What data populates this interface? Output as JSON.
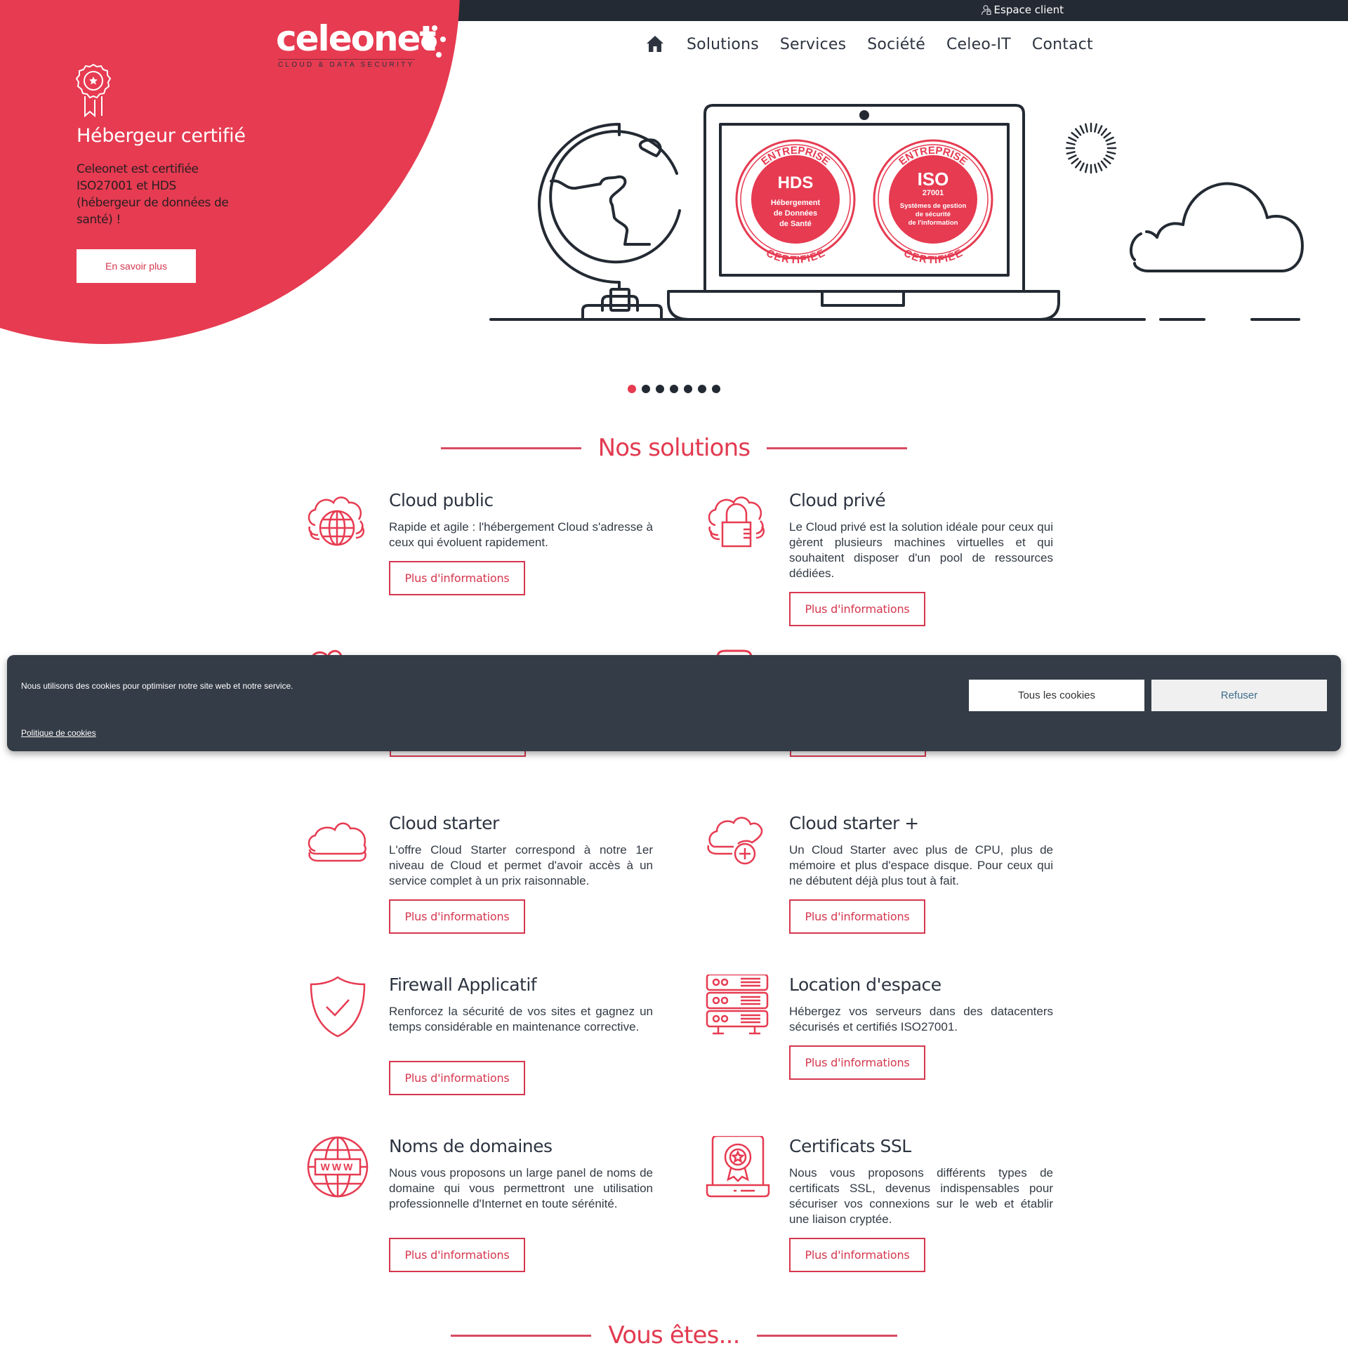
{
  "topbar": {
    "espace_client": "Espace client"
  },
  "logo": {
    "wordmark": "celeonet",
    "tagline": "CLOUD  &  DATA SECURITY"
  },
  "nav": {
    "items": [
      "Solutions",
      "Services",
      "Société",
      "Celeo-IT",
      "Contact"
    ]
  },
  "hero": {
    "title": "Hébergeur certifié",
    "text": "Celeonet est certifiée ISO27001 et HDS (hébergeur de données de santé) !",
    "button": "En savoir plus",
    "badges": [
      {
        "top": "ENTREPRISE",
        "main": "HDS",
        "sub": "",
        "lines": [
          "Hébergement",
          "de Données",
          "de Santé"
        ],
        "bottom": "CERTIFIÉE"
      },
      {
        "top": "ENTREPRISE",
        "main": "ISO",
        "sub": "27001",
        "lines": [
          "Systèmes de gestion",
          "de sécurité",
          "de l'information"
        ],
        "bottom": "CERTIFIÉE"
      }
    ],
    "slides_total": 7,
    "slide_active": 1
  },
  "colors": {
    "brand": "#e63b51",
    "dark": "#242a33",
    "text": "#2d3440"
  },
  "solutions": {
    "title": "Nos solutions",
    "more_label": "Plus d'informations",
    "items": [
      {
        "icon": "cloud-globe-icon",
        "title": "Cloud public",
        "text": "Rapide et agile : l'hébergement Cloud s'adresse à ceux qui évoluent rapidement."
      },
      {
        "icon": "cloud-lock-icon",
        "title": "Cloud privé",
        "text": "Le Cloud privé est la solution idéale pour ceux qui gèrent plusieurs machines virtuelles et qui souhaitent disposer d'un pool de ressources dédiées."
      },
      {
        "icon": "cloud-starter-icon",
        "title": "Cloud starter",
        "text": "L'offre Cloud Starter correspond à notre 1er niveau de Cloud et permet d'avoir accès à un service complet à un prix raisonnable."
      },
      {
        "icon": "cloud-plus-icon",
        "title": "Cloud starter +",
        "text": "Un Cloud Starter avec plus de CPU, plus de mémoire et plus d'espace disque. Pour ceux qui ne débutent déjà plus tout à fait."
      },
      {
        "icon": "shield-check-icon",
        "title": "Firewall Applicatif",
        "text": "Renforcez la sécurité de vos sites et gagnez un temps considérable en maintenance corrective."
      },
      {
        "icon": "server-rack-icon",
        "title": "Location d'espace",
        "text": "Hébergez vos serveurs dans des datacenters sécurisés et certifiés ISO27001."
      },
      {
        "icon": "globe-www-icon",
        "title": "Noms de domaines",
        "text": "Nous vous proposons un large panel de noms de domaine qui vous permettront une utilisation professionnelle d'Internet en toute sérénité."
      },
      {
        "icon": "certificate-laptop-icon",
        "title": "Certificats SSL",
        "text": "Nous vous proposons différents types de certificats SSL, devenus indispensables pour sécuriser vos connexions sur le web et établir une liaison cryptée."
      }
    ]
  },
  "vous_etes": {
    "title": "Vous êtes..."
  },
  "cookie": {
    "message": "Nous utilisons des cookies pour optimiser notre site web et notre service.",
    "policy_link": "Politique de cookies",
    "accept": "Tous les cookies",
    "refuse": "Refuser"
  }
}
